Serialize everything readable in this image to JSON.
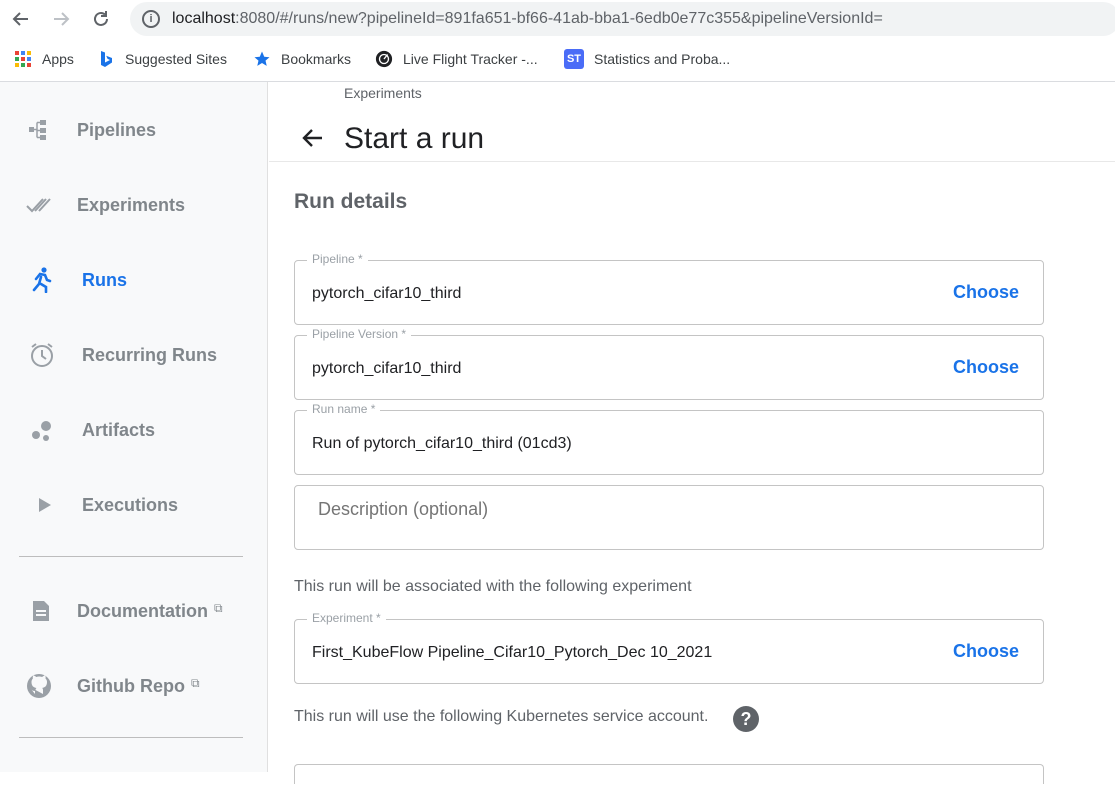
{
  "browser": {
    "url_host": "localhost",
    "url_rest": ":8080/#/runs/new?pipelineId=891fa651-bf66-41ab-bba1-6edb0e77c355&pipelineVersionId=",
    "bookmarks": [
      {
        "label": "Apps",
        "icon": "apps-grid-icon"
      },
      {
        "label": "Suggested Sites",
        "icon": "bing-icon"
      },
      {
        "label": "Bookmarks",
        "icon": "star-icon"
      },
      {
        "label": "Live Flight Tracker -...",
        "icon": "radar-icon"
      },
      {
        "label": "Statistics and Proba...",
        "icon": "st-icon"
      }
    ]
  },
  "sidebar": {
    "items": [
      {
        "label": "Pipelines",
        "icon": "pipelines-icon"
      },
      {
        "label": "Experiments",
        "icon": "experiments-icon"
      },
      {
        "label": "Runs",
        "icon": "runs-icon",
        "active": true
      },
      {
        "label": "Recurring Runs",
        "icon": "alarm-icon"
      },
      {
        "label": "Artifacts",
        "icon": "artifacts-icon"
      },
      {
        "label": "Executions",
        "icon": "play-icon"
      }
    ],
    "links": [
      {
        "label": "Documentation",
        "icon": "document-icon"
      },
      {
        "label": "Github Repo",
        "icon": "github-icon"
      }
    ]
  },
  "header": {
    "breadcrumb": "Experiments",
    "title": "Start a run"
  },
  "form": {
    "section_title": "Run details",
    "pipeline": {
      "label": "Pipeline *",
      "value": "pytorch_cifar10_third",
      "action": "Choose"
    },
    "pipeline_version": {
      "label": "Pipeline Version *",
      "value": "pytorch_cifar10_third",
      "action": "Choose"
    },
    "run_name": {
      "label": "Run name *",
      "value": "Run of pytorch_cifar10_third (01cd3)"
    },
    "description": {
      "placeholder": "Description (optional)"
    },
    "experiment_note": "This run will be associated with the following experiment",
    "experiment": {
      "label": "Experiment *",
      "value": "First_KubeFlow Pipeline_Cifar10_Pytorch_Dec 10_2021",
      "action": "Choose"
    },
    "service_account_note": "This run will use the following Kubernetes service account.",
    "help_symbol": "?"
  },
  "colors": {
    "accent": "#1a73e8",
    "sidebar_bg": "#f8f9fa",
    "muted": "#80868b"
  }
}
